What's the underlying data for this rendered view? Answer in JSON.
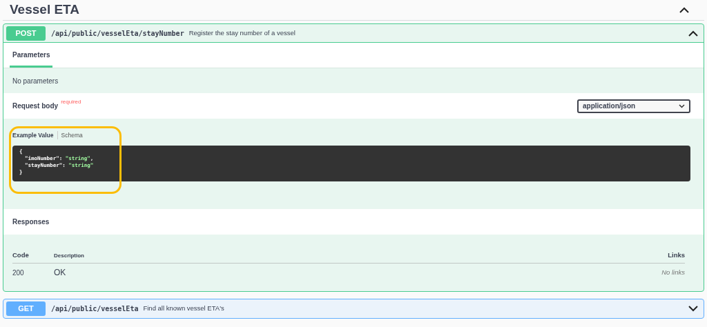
{
  "section": {
    "title": "Vessel ETA",
    "expanded": true
  },
  "operations": [
    {
      "method": "POST",
      "path": "/api/public/vesselEta/stayNumber",
      "summary": "Register the stay number of a vessel",
      "expanded": true,
      "tabs": [
        {
          "label": "Parameters",
          "selected": true
        }
      ],
      "parameters_note": "No parameters",
      "request_body": {
        "title": "Request body",
        "required_label": "required",
        "content_type": "application/json",
        "example_tabs": [
          {
            "label": "Example Value",
            "selected": true
          },
          {
            "label": "Schema",
            "selected": false
          }
        ],
        "example_lines": [
          [
            {
              "kind": "punct",
              "text": "{"
            }
          ],
          [
            {
              "kind": "key",
              "text": "\"imoNumber\""
            },
            {
              "kind": "punct",
              "text": ": "
            },
            {
              "kind": "string",
              "text": "\"string\""
            },
            {
              "kind": "punct",
              "text": ","
            }
          ],
          [
            {
              "kind": "key",
              "text": "\"stayNumber\""
            },
            {
              "kind": "punct",
              "text": ": "
            },
            {
              "kind": "string",
              "text": "\"string\""
            }
          ],
          [
            {
              "kind": "punct",
              "text": "}"
            }
          ]
        ],
        "highlighted": true
      },
      "responses": {
        "title": "Responses",
        "columns": [
          "Code",
          "Description",
          "Links"
        ],
        "rows": [
          {
            "code": "200",
            "description": "OK",
            "links": "No links"
          }
        ]
      }
    },
    {
      "method": "GET",
      "path": "/api/public/vesselEta",
      "summary": "Find all known vessel ETA's",
      "expanded": false
    }
  ]
}
